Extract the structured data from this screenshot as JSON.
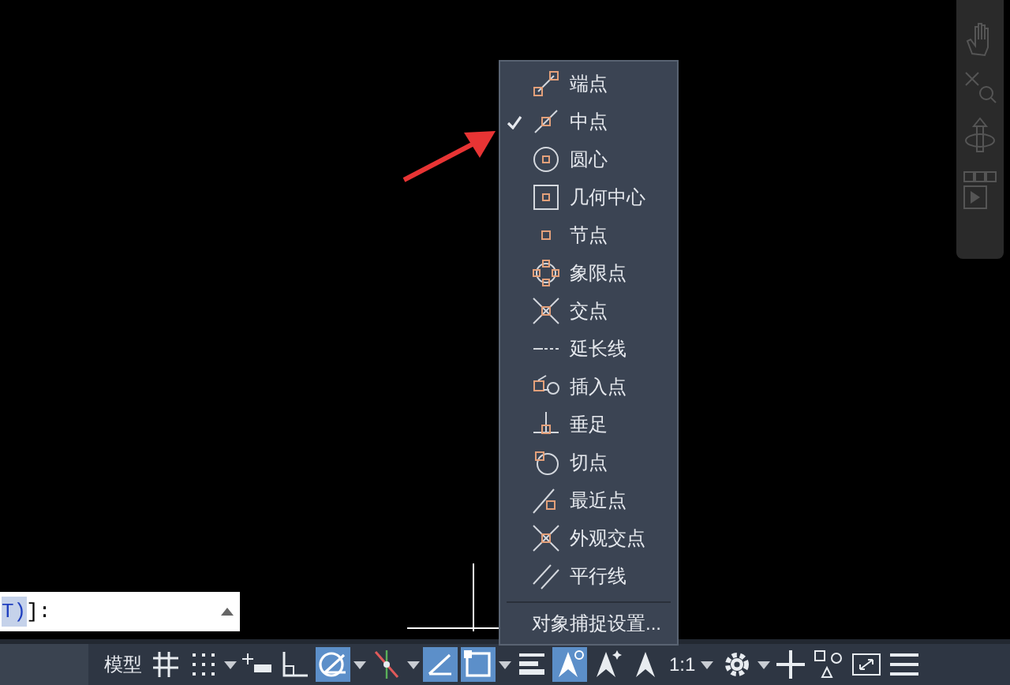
{
  "command_line": {
    "option": "T)",
    "rest": "]:"
  },
  "snap_menu": {
    "items": [
      {
        "label": "端点",
        "checked": false
      },
      {
        "label": "中点",
        "checked": true
      },
      {
        "label": "圆心",
        "checked": false
      },
      {
        "label": "几何中心",
        "checked": false
      },
      {
        "label": "节点",
        "checked": false
      },
      {
        "label": "象限点",
        "checked": false
      },
      {
        "label": "交点",
        "checked": false
      },
      {
        "label": "延长线",
        "checked": false
      },
      {
        "label": "插入点",
        "checked": false
      },
      {
        "label": "垂足",
        "checked": false
      },
      {
        "label": "切点",
        "checked": false
      },
      {
        "label": "最近点",
        "checked": false
      },
      {
        "label": "外观交点",
        "checked": false
      },
      {
        "label": "平行线",
        "checked": false
      }
    ],
    "settings": "对象捕捉设置..."
  },
  "status_bar": {
    "items": [
      {
        "kind": "label",
        "label": "模型"
      },
      {
        "kind": "toggle",
        "on": false
      },
      {
        "kind": "toggle",
        "on": false
      },
      {
        "kind": "toggle",
        "on": false
      },
      {
        "kind": "toggle",
        "on": false
      },
      {
        "kind": "toggle",
        "on": true
      },
      {
        "kind": "toggle",
        "on": false
      },
      {
        "kind": "toggle",
        "on": true
      },
      {
        "kind": "toggle",
        "on": true
      },
      {
        "kind": "toggle",
        "on": false
      },
      {
        "kind": "toggle",
        "on": true
      },
      {
        "kind": "toggle",
        "on": false
      },
      {
        "kind": "toggle",
        "on": false
      },
      {
        "kind": "label",
        "label": "1:1"
      },
      {
        "kind": "toggle",
        "on": false
      },
      {
        "kind": "toggle",
        "on": false
      },
      {
        "kind": "toggle",
        "on": false
      },
      {
        "kind": "toggle",
        "on": false
      },
      {
        "kind": "toggle",
        "on": false
      }
    ]
  }
}
